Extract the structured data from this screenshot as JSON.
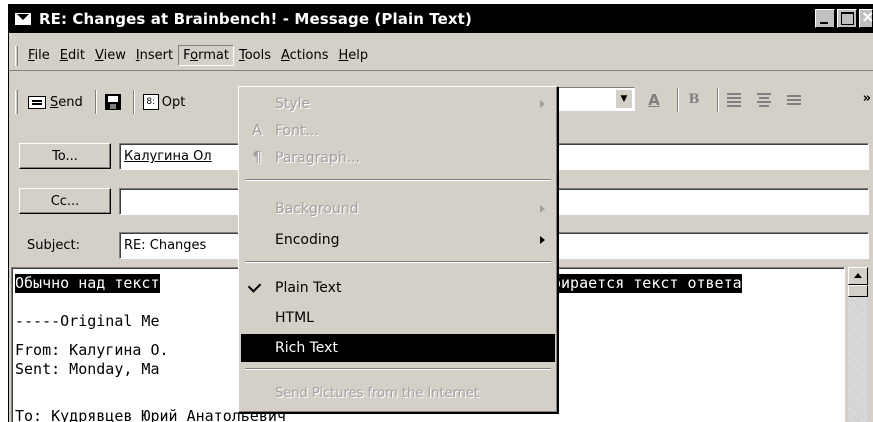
{
  "window": {
    "title": "RE: Changes at Brainbench! - Message (Plain Text)"
  },
  "menubar": {
    "items": [
      {
        "pre": "",
        "ul": "F",
        "post": "ile"
      },
      {
        "pre": "",
        "ul": "E",
        "post": "dit"
      },
      {
        "pre": "",
        "ul": "V",
        "post": "iew"
      },
      {
        "pre": "",
        "ul": "I",
        "post": "nsert"
      },
      {
        "pre": "F",
        "ul": "o",
        "post": "rmat"
      },
      {
        "pre": "",
        "ul": "T",
        "post": "ools"
      },
      {
        "pre": "",
        "ul": "A",
        "post": "ctions"
      },
      {
        "pre": "",
        "ul": "H",
        "post": "elp"
      }
    ]
  },
  "toolbar": {
    "send_label": "Send",
    "send_ul": "S",
    "send_rest": "end",
    "options_label": "Opt",
    "icons": [
      "send-icon",
      "save-icon",
      "options-icon",
      "font-color-icon",
      "bold-icon",
      "align-left-icon",
      "center-icon",
      "bullets-icon",
      "more-chevron-icon"
    ],
    "font_color_glyph": "A",
    "bold_glyph": "B",
    "overflow_glyph": "»"
  },
  "header": {
    "to_label": "To...",
    "cc_label": "Cc...",
    "subject_label": "Subject:",
    "to_value": "Калугина Ол",
    "cc_value": "",
    "subject_value": "RE: Changes"
  },
  "body": {
    "lines": [
      "Обычно над текст",
      "",
      "-----Original Me",
      "From: Калугина О.",
      "Sent: Monday, Ma",
      "To: Кудрявцев Юрий Анатольевич"
    ],
    "right_fragment": "бирается текст ответа"
  },
  "format_menu": {
    "items": [
      {
        "label": "Style",
        "state": "disabled",
        "submenu": true
      },
      {
        "label": "Font...",
        "state": "disabled",
        "icon": "A"
      },
      {
        "label": "Paragraph...",
        "state": "disabled",
        "icon": "¶"
      },
      {
        "label": "Background",
        "state": "disabled",
        "submenu": true
      },
      {
        "label": "Encoding",
        "state": "enabled",
        "submenu": true
      },
      {
        "label": "Plain Text",
        "state": "checked"
      },
      {
        "label": "HTML",
        "state": "enabled"
      },
      {
        "label": "Rich Text",
        "state": "highlighted"
      },
      {
        "label": "Send Pictures from the Internet",
        "state": "disabled"
      }
    ]
  }
}
